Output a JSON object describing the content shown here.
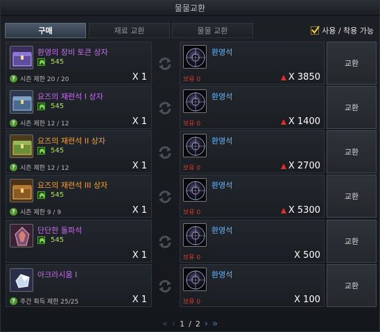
{
  "window": {
    "title": "물물교환"
  },
  "tabs": [
    {
      "label": "구매",
      "active": true
    },
    {
      "label": "재료 교환",
      "active": false
    },
    {
      "label": "물물 교환",
      "active": false
    }
  ],
  "filter": {
    "label": "사용 / 착용 가능",
    "checked": true
  },
  "rows": [
    {
      "name": "환영의 장비 토큰 상자",
      "name_color": "#c86cf0",
      "icon": "purple-chest-icon",
      "price": "545",
      "limit": "시즌 제한 20 / 20",
      "qty": "X 1",
      "reward": "환영석",
      "owned": "보유 0",
      "cost": "X 3850",
      "cost_arrow": true,
      "action": "교환"
    },
    {
      "name": "요즈의 재련석 I 상자",
      "name_color": "#c86cf0",
      "icon": "blue-chest-icon",
      "price": "545",
      "limit": "시즌 제한 12 / 12",
      "qty": "X 1",
      "reward": "환영석",
      "owned": "보유 0",
      "cost": "X 1400",
      "cost_arrow": true,
      "action": "교환"
    },
    {
      "name": "요즈의 재련석 II 상자",
      "name_color": "#f0a13a",
      "icon": "green-chest-icon",
      "price": "545",
      "limit": "시즌 제한 12 / 12",
      "qty": "X 1",
      "reward": "환영석",
      "owned": "보유 0",
      "cost": "X 2700",
      "cost_arrow": true,
      "action": "교환"
    },
    {
      "name": "요즈의 재련석 III 상자",
      "name_color": "#f0a13a",
      "icon": "gold-chest-icon",
      "price": "545",
      "limit": "시즌 제한 9 / 9",
      "qty": "X 1",
      "reward": "환영석",
      "owned": "보유 0",
      "cost": "X 5300",
      "cost_arrow": true,
      "action": "교환"
    },
    {
      "name": "단단한 돌파석",
      "name_color": "#c86cf0",
      "icon": "breakthrough-stone-icon",
      "price": "545",
      "limit": "",
      "qty": "X 1",
      "reward": "환영석",
      "owned": "보유 0",
      "cost": "X 500",
      "cost_arrow": false,
      "action": "교환"
    },
    {
      "name": "아크라시움 I",
      "name_color": "#c86cf0",
      "icon": "crystal-icon",
      "price": "",
      "limit": "주간 획득 제한 25/25",
      "qty": "X 1",
      "reward": "환영석",
      "owned": "보유 0",
      "cost": "X 100",
      "cost_arrow": false,
      "action": "교환"
    }
  ],
  "pager": {
    "current": "1",
    "total": "2",
    "separator": "/"
  }
}
